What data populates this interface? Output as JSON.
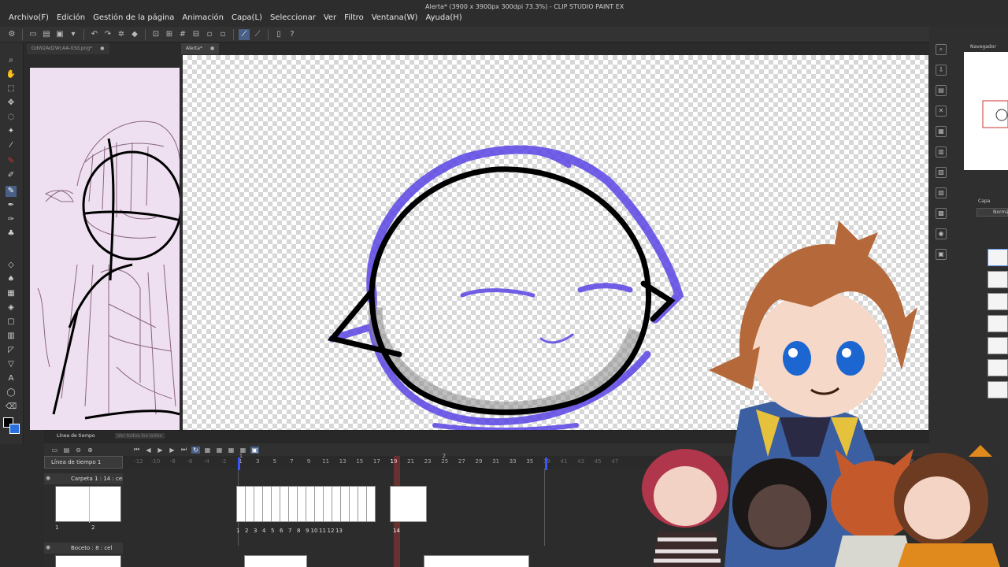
{
  "window": {
    "title": "Alerta* (3900 x 3900px 300dpi 73.3%) - CLIP STUDIO PAINT EX"
  },
  "menu": {
    "items": [
      "Archivo(F)",
      "Edición",
      "Gestión de la página",
      "Animación",
      "Capa(L)",
      "Seleccionar",
      "Ver",
      "Filtro",
      "Ventana(W)",
      "Ayuda(H)"
    ]
  },
  "tabs": {
    "sub_view": "GdW2Ad2WcAA-03d.png*",
    "main_doc": "Alerta*"
  },
  "right_panel": {
    "navigator_label": "Navegador",
    "layer_label": "Capa",
    "blend_mode": "Normal"
  },
  "timeline": {
    "tab_label": "Línea de tiempo",
    "tab_label_2": "Ver todos los lados",
    "timeline_name": "Línea de tiempo 1",
    "ruler_ticks": [
      "-12",
      "-10",
      "-8",
      "-6",
      "-4",
      "-2",
      "1",
      "3",
      "5",
      "7",
      "9",
      "11",
      "13",
      "15",
      "17",
      "19",
      "21",
      "23",
      "25",
      "27",
      "29",
      "31",
      "33",
      "35",
      "39",
      "41",
      "43",
      "45",
      "47",
      "36"
    ],
    "ruler_marks": [
      "1",
      "2"
    ],
    "current_frame": "19",
    "tracks": [
      {
        "label": "Carpeta 1 : 14 : cel",
        "thumb_numbers": [
          "1",
          "2"
        ]
      },
      {
        "label": "Boceto : 8 : cel",
        "thumb_numbers": []
      }
    ],
    "cel_numbers": [
      "1",
      "2",
      "3",
      "4",
      "5",
      "6",
      "7",
      "8",
      "9",
      "10",
      "11",
      "12",
      "13"
    ],
    "cel_single": "14"
  },
  "colors": {
    "main_color": "#000000",
    "sub_color": "#2a6fe0",
    "accent": "#4a5f85",
    "playhead": "#d23c3c",
    "range_marker": "#3a55ff"
  }
}
